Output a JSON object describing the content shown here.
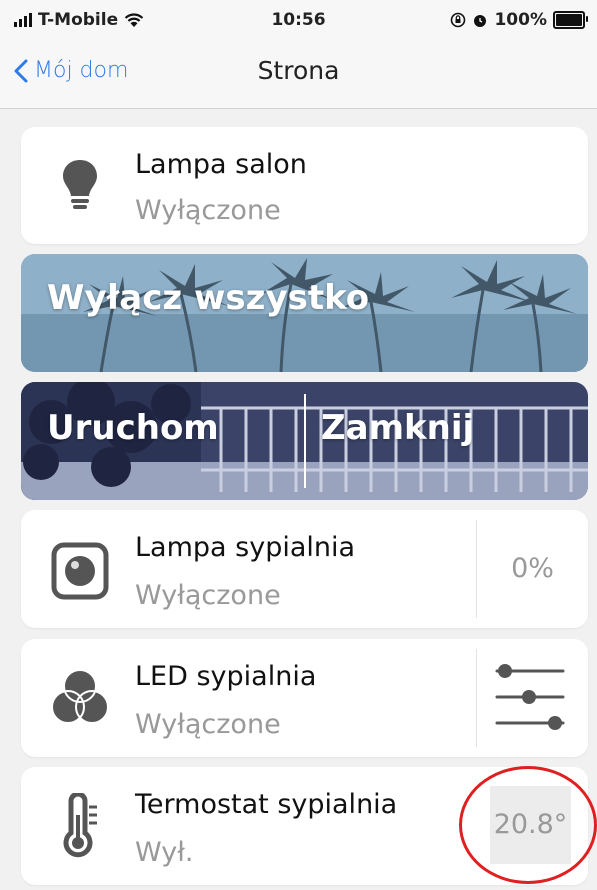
{
  "status_bar": {
    "carrier": "T-Mobile",
    "time": "10:56",
    "battery_pct": "100%"
  },
  "nav": {
    "back_label": "Mój dom",
    "title": "Strona"
  },
  "devices": [
    {
      "name": "Lampa salon",
      "state": "Wyłączone",
      "icon": "lightbulb-icon"
    },
    {
      "name": "Lampa sypialnia",
      "state": "Wyłączone",
      "icon": "dimmer-icon",
      "value": "0%"
    },
    {
      "name": "LED sypialnia",
      "state": "Wyłączone",
      "icon": "rgb-icon"
    },
    {
      "name": "Termostat sypialnia",
      "state": "Wył.",
      "icon": "thermometer-icon",
      "value": "20.8°"
    }
  ],
  "scenes": {
    "all_off": "Wyłącz wszystko",
    "open": "Uruchom",
    "close": "Zamknij"
  },
  "colors": {
    "accent": "#2f7ae5",
    "muted": "#999999",
    "annotation": "#e02020"
  }
}
